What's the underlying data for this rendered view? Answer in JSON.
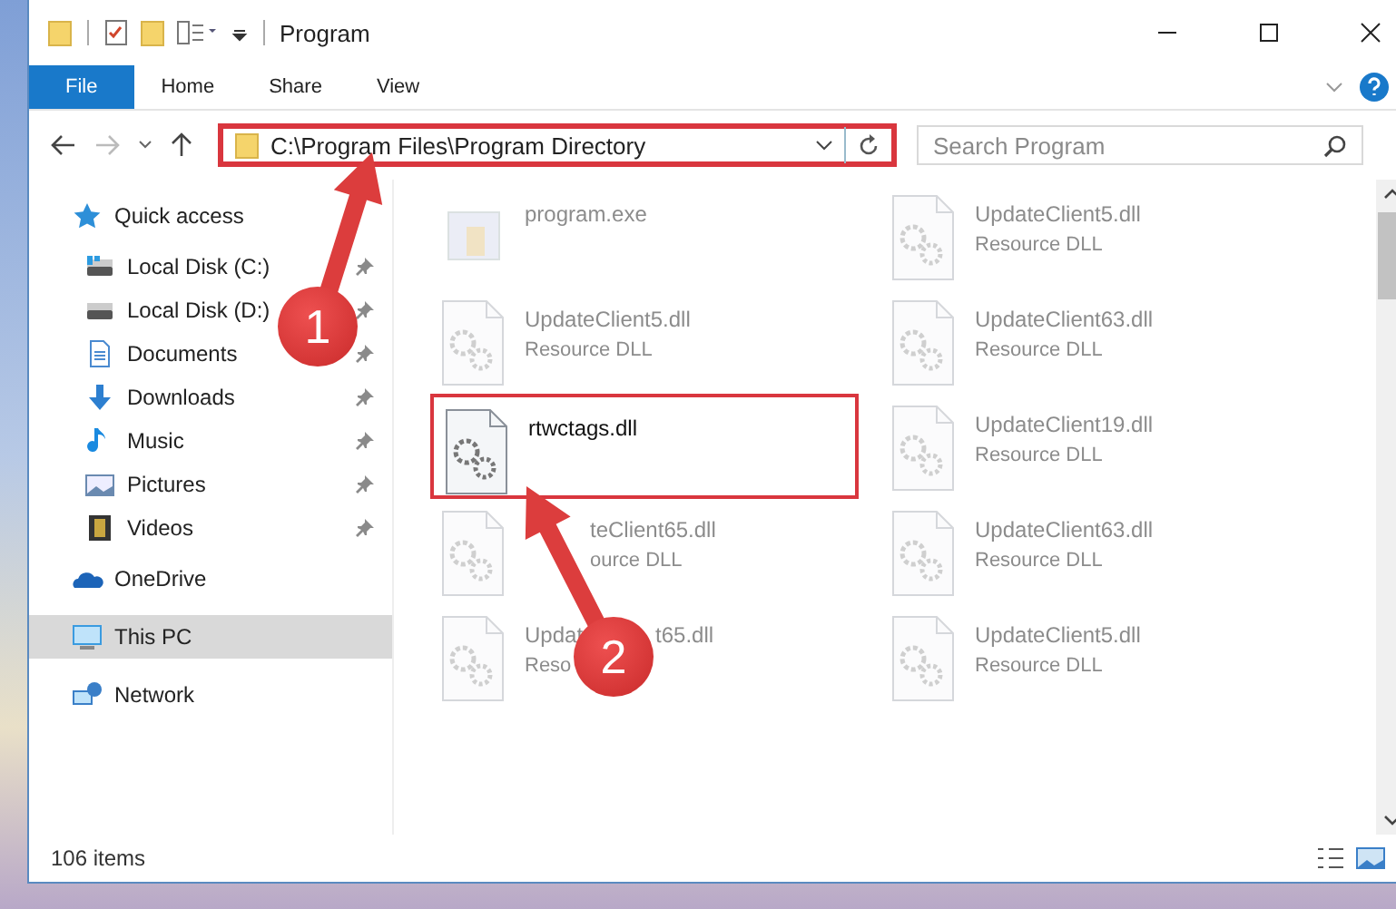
{
  "window": {
    "title": "Program"
  },
  "ribbon": {
    "tabs": [
      {
        "label": "File",
        "selected": true
      },
      {
        "label": "Home",
        "selected": false
      },
      {
        "label": "Share",
        "selected": false
      },
      {
        "label": "View",
        "selected": false
      }
    ]
  },
  "address_bar": {
    "path": "C:\\Program Files\\Program Directory",
    "highlighted": true
  },
  "search": {
    "placeholder": "Search Program"
  },
  "sidebar": {
    "items": [
      {
        "label": "Quick access",
        "kind": "star",
        "selected": false,
        "children": [
          {
            "label": "Local Disk (C:)",
            "kind": "disk-c",
            "pinned": true
          },
          {
            "label": "Local Disk (D:)",
            "kind": "disk",
            "pinned": true
          },
          {
            "label": "Documents",
            "kind": "document",
            "pinned": true
          },
          {
            "label": "Downloads",
            "kind": "download",
            "pinned": true
          },
          {
            "label": "Music",
            "kind": "music",
            "pinned": true
          },
          {
            "label": "Pictures",
            "kind": "picture",
            "pinned": true
          },
          {
            "label": "Videos",
            "kind": "video",
            "pinned": true
          }
        ]
      },
      {
        "label": "OneDrive",
        "kind": "cloud",
        "selected": false
      },
      {
        "label": "This PC",
        "kind": "pc",
        "selected": true
      },
      {
        "label": "Network",
        "kind": "network",
        "selected": false
      }
    ]
  },
  "files": [
    {
      "name": "program.exe",
      "kind": "exe",
      "faded": true,
      "highlighted": false
    },
    {
      "name": "UpdateClient5.dll",
      "type": "Resource DLL",
      "kind": "dll",
      "faded": true,
      "highlighted": false
    },
    {
      "name": "UpdateClient5.dll",
      "type": "Resource DLL",
      "kind": "dll",
      "faded": true,
      "highlighted": false
    },
    {
      "name": "UpdateClient63.dll",
      "type": "Resource DLL",
      "kind": "dll",
      "faded": true,
      "highlighted": false
    },
    {
      "name": "rtwctags.dll",
      "kind": "dll",
      "faded": false,
      "highlighted": true
    },
    {
      "name": "UpdateClient19.dll",
      "type": "Resource DLL",
      "kind": "dll",
      "faded": true,
      "highlighted": false
    },
    {
      "name": "teClient65.dll",
      "type": "ource DLL",
      "kind": "dll",
      "faded": true,
      "highlighted": false,
      "covered_start": true
    },
    {
      "name": "UpdateClient63.dll",
      "type": "Resource DLL",
      "kind": "dll",
      "faded": true,
      "highlighted": false
    },
    {
      "name": "Updat",
      "name_tail": "t65.dll",
      "type": "Reso",
      "kind": "dll",
      "faded": true,
      "highlighted": false
    },
    {
      "name": "UpdateClient5.dll",
      "type": "Resource DLL",
      "kind": "dll",
      "faded": true,
      "highlighted": false
    }
  ],
  "status_bar": {
    "item_count": "106 items"
  },
  "annotations": [
    {
      "number": "1"
    },
    {
      "number": "2"
    }
  ]
}
